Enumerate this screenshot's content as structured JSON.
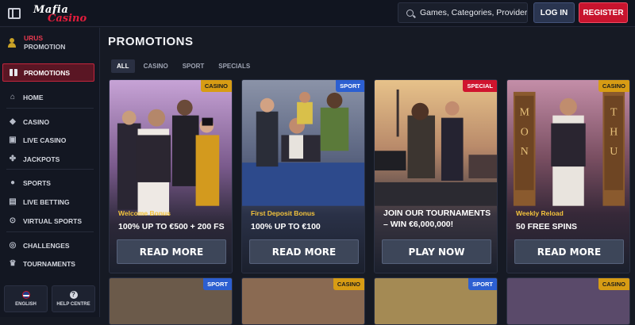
{
  "header": {
    "logo_line1": "Mafia",
    "logo_line2": "Casino",
    "search_placeholder": "Games, Categories, Providers",
    "login_label": "LOG IN",
    "register_label": "REGISTER"
  },
  "sidebar": {
    "user_name": "URUS",
    "user_sub": "PROMOTION",
    "active_item": "PROMOTIONS",
    "items": [
      {
        "label": "HOME",
        "icon": "home-icon"
      },
      {
        "label": "CASINO",
        "icon": "diamond-icon"
      },
      {
        "label": "LIVE CASINO",
        "icon": "cards-icon"
      },
      {
        "label": "JACKPOTS",
        "icon": "clover-icon"
      },
      {
        "label": "SPORTS",
        "icon": "ball-icon"
      },
      {
        "label": "LIVE BETTING",
        "icon": "live-icon"
      },
      {
        "label": "VIRTUAL SPORTS",
        "icon": "virtual-icon"
      },
      {
        "label": "CHALLENGES",
        "icon": "target-icon"
      },
      {
        "label": "TOURNAMENTS",
        "icon": "trophy-icon"
      }
    ],
    "language_label": "ENGLISH",
    "help_label": "HELP CENTRE"
  },
  "main": {
    "title": "PROMOTIONS",
    "tabs": [
      "ALL",
      "CASINO",
      "SPORT",
      "SPECIALS"
    ],
    "cards": [
      {
        "badge": "CASINO",
        "badge_type": "casino",
        "subtitle": "Welcome Bonus",
        "title": "100% UP TO €500 + 200 FS",
        "button": "READ MORE"
      },
      {
        "badge": "SPORT",
        "badge_type": "sport",
        "subtitle": "First Deposit Bonus",
        "title": "100% UP TO €100",
        "button": "READ MORE"
      },
      {
        "badge": "SPECIAL",
        "badge_type": "special",
        "subtitle": "",
        "title": "JOIN OUR TOURNAMENTS – WIN €6,000,000!",
        "button": "PLAY NOW"
      },
      {
        "badge": "CASINO",
        "badge_type": "casino",
        "subtitle": "Weekly Reload",
        "title": "50 FREE SPINS",
        "button": "READ MORE"
      }
    ],
    "next_row_badges": [
      "SPORT",
      "CASINO",
      "SPORT",
      "CASINO"
    ]
  }
}
